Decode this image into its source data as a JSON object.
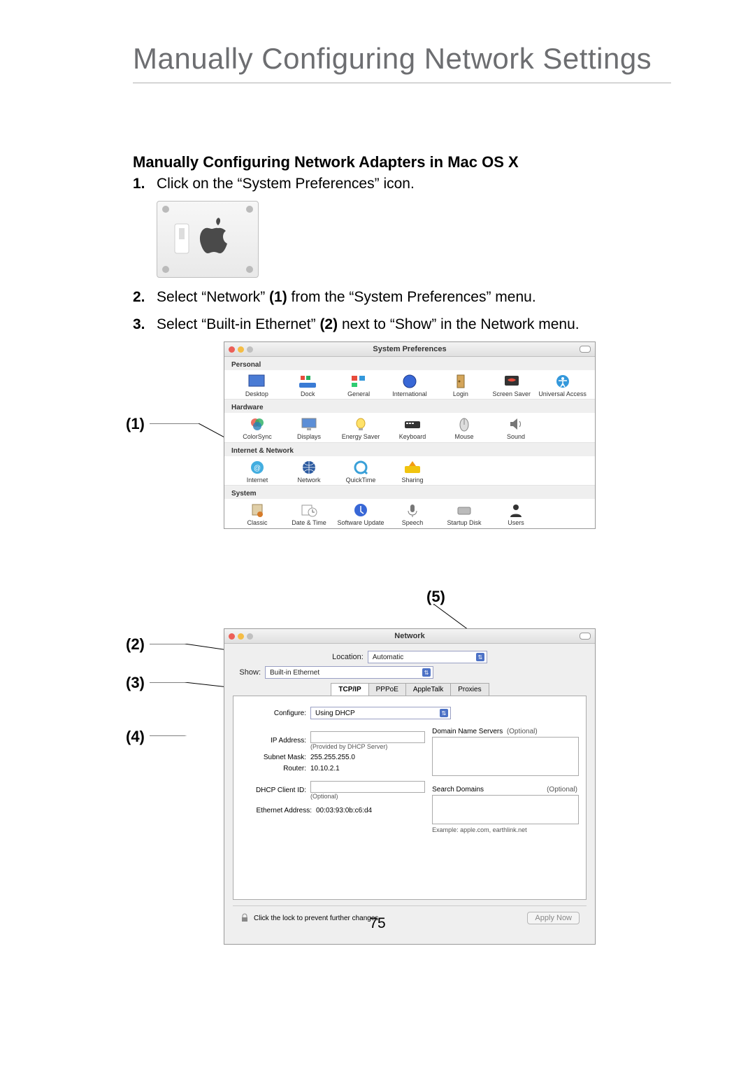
{
  "page_title": "Manually Configuring Network Settings",
  "section_heading": "Manually Configuring Network Adapters in Mac OS X",
  "steps": {
    "s1_num": "1.",
    "s1_text": "Click on the “System Preferences” icon.",
    "s2_num": "2.",
    "s2_a": "Select “Network” ",
    "s2_b": "(1)",
    "s2_c": " from the “System Preferences” menu.",
    "s3_num": "3.",
    "s3_a": "Select “Built-in Ethernet” ",
    "s3_b": "(2)",
    "s3_c": " next to “Show” in the Network menu."
  },
  "callouts": {
    "c1": "(1)",
    "c2": "(2)",
    "c3": "(3)",
    "c4": "(4)",
    "c5": "(5)"
  },
  "sysprefs": {
    "title": "System Preferences",
    "groups": {
      "personal": "Personal",
      "hardware": "Hardware",
      "internet": "Internet & Network",
      "system": "System"
    },
    "personal": [
      "Desktop",
      "Dock",
      "General",
      "International",
      "Login",
      "Screen Saver",
      "Universal Access"
    ],
    "hardware": [
      "ColorSync",
      "Displays",
      "Energy Saver",
      "Keyboard",
      "Mouse",
      "Sound"
    ],
    "internet": [
      "Internet",
      "Network",
      "QuickTime",
      "Sharing"
    ],
    "system": [
      "Classic",
      "Date & Time",
      "Software Update",
      "Speech",
      "Startup Disk",
      "Users"
    ]
  },
  "network": {
    "title": "Network",
    "location_label": "Location:",
    "location_value": "Automatic",
    "show_label": "Show:",
    "show_value": "Built-in Ethernet",
    "tabs": {
      "t1": "TCP/IP",
      "t2": "PPPoE",
      "t3": "AppleTalk",
      "t4": "Proxies"
    },
    "configure_label": "Configure:",
    "configure_value": "Using DHCP",
    "ip_label": "IP Address:",
    "ip_note": "(Provided by DHCP Server)",
    "subnet_label": "Subnet Mask:",
    "subnet_value": "255.255.255.0",
    "router_label": "Router:",
    "router_value": "10.10.2.1",
    "dhcp_id_label": "DHCP Client ID:",
    "dhcp_id_note": "(Optional)",
    "eth_label": "Ethernet Address:",
    "eth_value": "00:03:93:0b:c6:d4",
    "dns_head": "Domain Name Servers",
    "dns_opt": "(Optional)",
    "search_head": "Search Domains",
    "search_opt": "(Optional)",
    "search_example": "Example: apple.com, earthlink.net",
    "lock_text": "Click the lock to prevent further changes.",
    "apply": "Apply Now"
  },
  "page_number": "75"
}
